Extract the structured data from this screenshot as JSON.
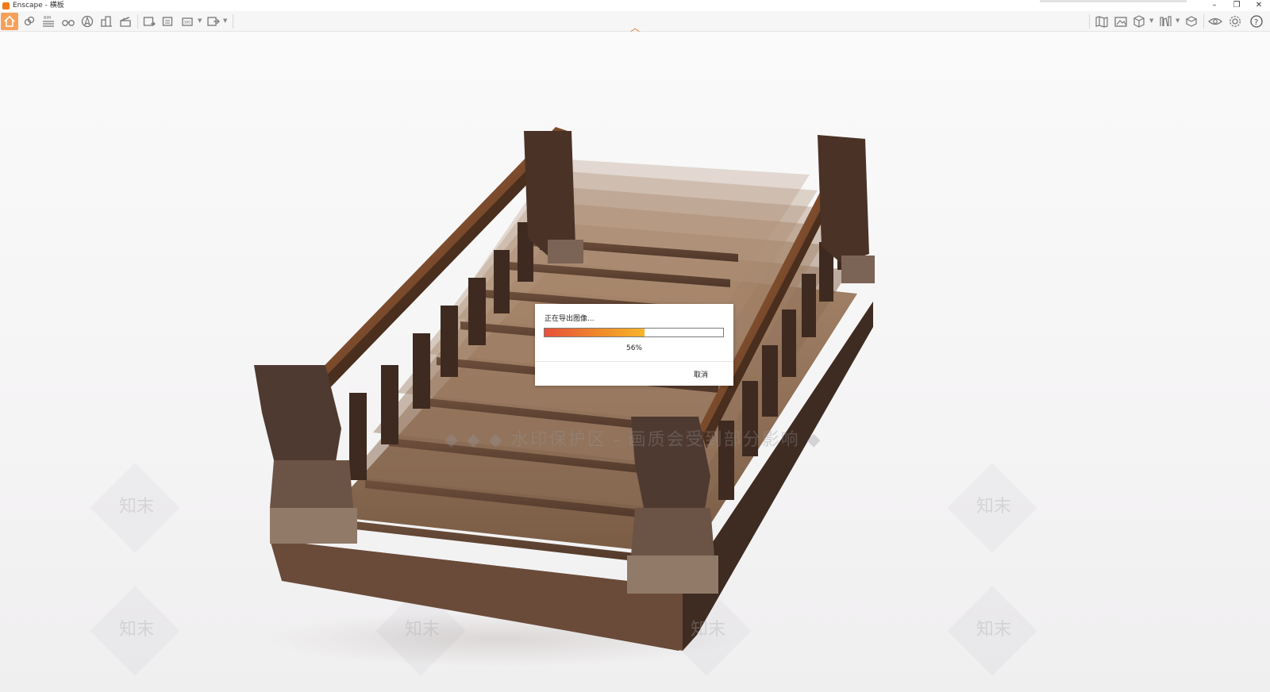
{
  "window": {
    "title": "Enscape - 横板",
    "controls": {
      "minimize": "–",
      "restore": "❐",
      "close": "✕"
    }
  },
  "toolbar": {
    "accent_color": "#f6a15b",
    "left_tools": [
      "home-icon",
      "link-icon",
      "bim-icon",
      "binoculars-icon",
      "navigation-icon",
      "building-icon",
      "clapper-icon",
      "screenshot-icon",
      "batch-render-icon",
      "panorama-icon",
      "export-icon"
    ],
    "right_tools": [
      "map-icon",
      "image-icon",
      "cube-icon",
      "library-icon",
      "material-icon",
      "eye-icon",
      "gear-icon",
      "help-icon"
    ]
  },
  "viewport": {
    "watermark": "◆ ◆ ◆ 水印保护区 - 画质会受到部分影响 ◆",
    "watermark_brand": "知末"
  },
  "export_dialog": {
    "title": "正在导出图像...",
    "progress": 0.56,
    "progress_text": "56%",
    "cancel_label": "取消",
    "progress_colors": [
      "#e8503a",
      "#ef8a2a",
      "#f7b42a"
    ]
  }
}
